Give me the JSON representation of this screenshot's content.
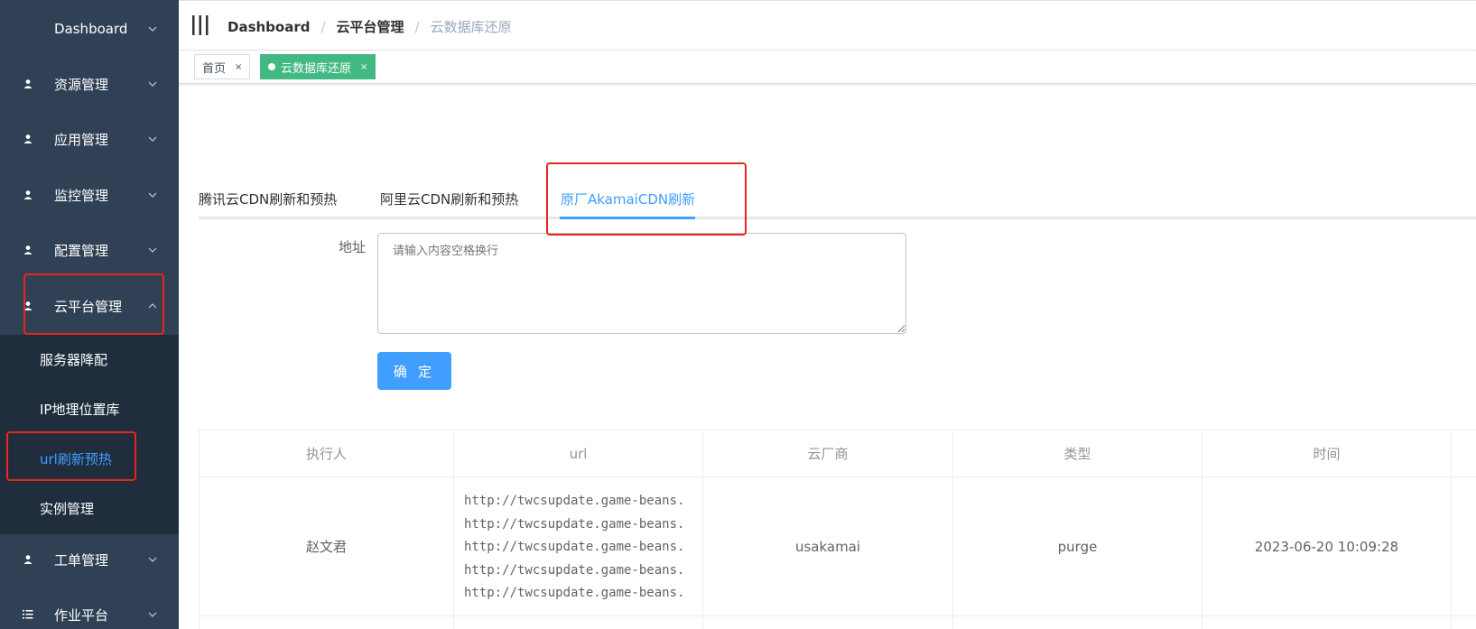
{
  "sidebar": {
    "items": [
      {
        "label": "Dashboard",
        "icon": "none"
      },
      {
        "label": "资源管理",
        "icon": "user-icon"
      },
      {
        "label": "应用管理",
        "icon": "user-icon"
      },
      {
        "label": "监控管理",
        "icon": "user-icon"
      },
      {
        "label": "配置管理",
        "icon": "user-icon"
      },
      {
        "label": "云平台管理",
        "icon": "user-icon",
        "expanded": true
      },
      {
        "label": "工单管理",
        "icon": "user-icon"
      },
      {
        "label": "作业平台",
        "icon": "list-icon"
      }
    ],
    "submenu": [
      {
        "label": "服务器降配",
        "active": false
      },
      {
        "label": "IP地理位置库",
        "active": false
      },
      {
        "label": "url刷新预热",
        "active": true
      },
      {
        "label": "实例管理",
        "active": false
      }
    ]
  },
  "navbar": {
    "breadcrumb": [
      "Dashboard",
      "云平台管理",
      "云数据库还原"
    ],
    "separator": "/"
  },
  "tags": [
    {
      "label": "首页",
      "close": "×",
      "active": false
    },
    {
      "label": "云数据库还原",
      "close": "×",
      "active": true
    }
  ],
  "tabs": [
    {
      "label": "腾讯云CDN刷新和预热",
      "active": false
    },
    {
      "label": "阿里云CDN刷新和预热",
      "active": false
    },
    {
      "label": "原厂AkamaiCDN刷新",
      "active": true
    }
  ],
  "form": {
    "address_label": "地址",
    "address_placeholder": "请输入内容空格换行",
    "confirm_label": "确 定"
  },
  "table": {
    "columns": [
      "执行人",
      "url",
      "云厂商",
      "类型",
      "时间"
    ],
    "rows": [
      {
        "executor": "赵文君",
        "urls": [
          "http://twcsupdate.game-beans.",
          "http://twcsupdate.game-beans.",
          "http://twcsupdate.game-beans.",
          "http://twcsupdate.game-beans.",
          "http://twcsupdate.game-beans."
        ],
        "vendor": "usakamai",
        "type": "purge",
        "time": "2023-06-20 10:09:28"
      }
    ]
  },
  "colors": {
    "sidebar_bg": "#304156",
    "submenu_bg": "#1f2d3d",
    "accent": "#409eff",
    "tag_active": "#42b983",
    "highlight_box": "#e8271c"
  }
}
